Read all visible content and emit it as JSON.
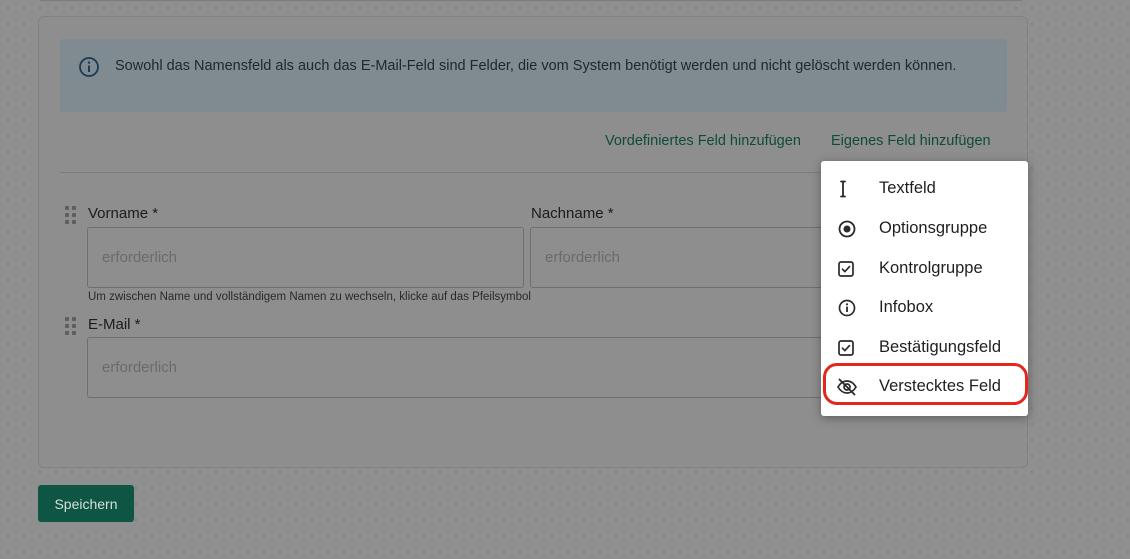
{
  "info_banner": {
    "text": "Sowohl das Namensfeld als auch das E-Mail-Feld sind Felder, die vom System benötigt werden und nicht gelöscht werden können.",
    "icon": "info-circle-icon"
  },
  "actions": {
    "add_predefined": "Vordefiniertes Feld hinzufügen",
    "add_custom": "Eigenes Feld hinzufügen"
  },
  "fields": {
    "first_name": {
      "label": "Vorname *",
      "placeholder": "erforderlich"
    },
    "last_name": {
      "label": "Nachname *",
      "placeholder": "erforderlich"
    },
    "name_hint": "Um zwischen Name und vollständigem Namen zu wechseln, klicke auf das Pfeilsymbol",
    "email": {
      "label": "E-Mail *",
      "placeholder": "erforderlich"
    }
  },
  "save_label": "Speichern",
  "menu": {
    "items": [
      {
        "label": "Textfeld",
        "icon": "text-cursor-icon"
      },
      {
        "label": "Optionsgruppe",
        "icon": "radio-button-icon"
      },
      {
        "label": "Kontrolgruppe",
        "icon": "checkbox-icon"
      },
      {
        "label": "Infobox",
        "icon": "info-icon"
      },
      {
        "label": "Bestätigungsfeld",
        "icon": "checkbox-icon"
      },
      {
        "label": "Verstecktes Feld",
        "icon": "eye-off-icon"
      }
    ]
  },
  "colors": {
    "accent": "#0f5544",
    "link": "#0f4b3c",
    "highlight": "#e5261b"
  }
}
